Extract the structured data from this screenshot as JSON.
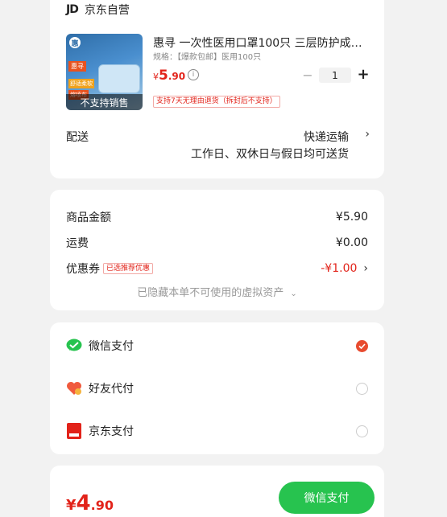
{
  "store": {
    "logo_text": "JD",
    "name": "京东自营"
  },
  "product": {
    "thumb_brand": "惠",
    "thumb_tag1": "惠寻",
    "thumb_tag2": "舒适柔软",
    "thumb_tag3": "熔喷布",
    "overlay": "不支持销售",
    "title": "惠寻 一次性医用口罩100只 三层防护成人…",
    "spec": "规格：【爆款包邮】医用100只",
    "price_symbol": "¥",
    "price_int": "5",
    "price_dec": ".90",
    "quantity": "1",
    "return_policy": "支持7天无理由退货（拆封后不支持）"
  },
  "shipping": {
    "label": "配送",
    "method": "快递运输",
    "description": "工作日、双休日与假日均可送货"
  },
  "summary": {
    "goods_label": "商品金额",
    "goods_value": "¥5.90",
    "freight_label": "运费",
    "freight_value": "¥0.00",
    "coupon_label": "优惠券",
    "coupon_badge": "已选推荐优惠",
    "coupon_value": "-¥1.00",
    "hidden_note": "已隐藏本单不可使用的虚拟资产"
  },
  "payment": {
    "options": [
      {
        "label": "微信支付",
        "icon": "wechat-pay-icon",
        "selected": true
      },
      {
        "label": "好友代付",
        "icon": "friend-pay-icon",
        "selected": false
      },
      {
        "label": "京东支付",
        "icon": "jd-pay-icon",
        "selected": false
      }
    ]
  },
  "bottom": {
    "price_symbol": "¥",
    "total_int": "4",
    "total_dec": ".90",
    "pay_button": "微信支付"
  },
  "colors": {
    "accent_red": "#e2231a",
    "wechat_green": "#27c34f",
    "checked_orange": "#e84b2f"
  }
}
